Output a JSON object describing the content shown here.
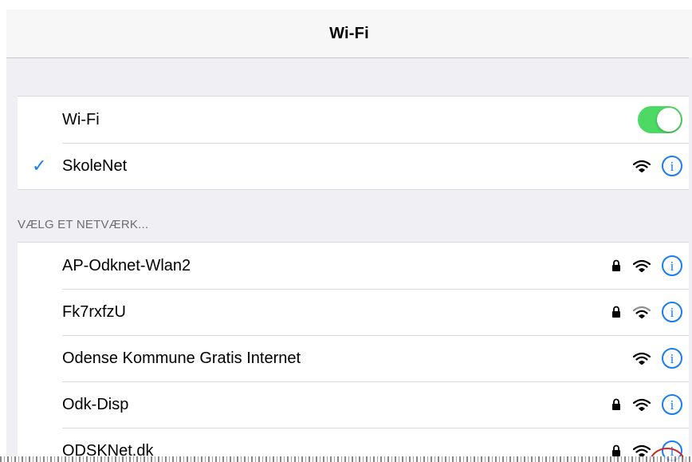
{
  "nav": {
    "title": "Wi-Fi"
  },
  "wifi_toggle": {
    "label": "Wi-Fi",
    "state": "on",
    "color": "#4cd964"
  },
  "connected": {
    "check_icon": "checkmark-icon",
    "name": "SkoleNet"
  },
  "section_header": "VÆLG ET NETVÆRK...",
  "networks": [
    {
      "name": "AP-Odknet-Wlan2",
      "locked": true
    },
    {
      "name": "Fk7rxfzU",
      "locked": true
    },
    {
      "name": "Odense Kommune Gratis Internet",
      "locked": false
    },
    {
      "name": "Odk-Disp",
      "locked": true
    },
    {
      "name": "ODSKNet.dk",
      "locked": true,
      "highlighted": true
    }
  ],
  "colors": {
    "accent": "#1a7cf5",
    "highlight": "#c62828",
    "background": "#efeff4"
  },
  "icons": {
    "lock": "lock-icon",
    "wifi": "wifi-signal-icon",
    "info": "info-icon"
  }
}
